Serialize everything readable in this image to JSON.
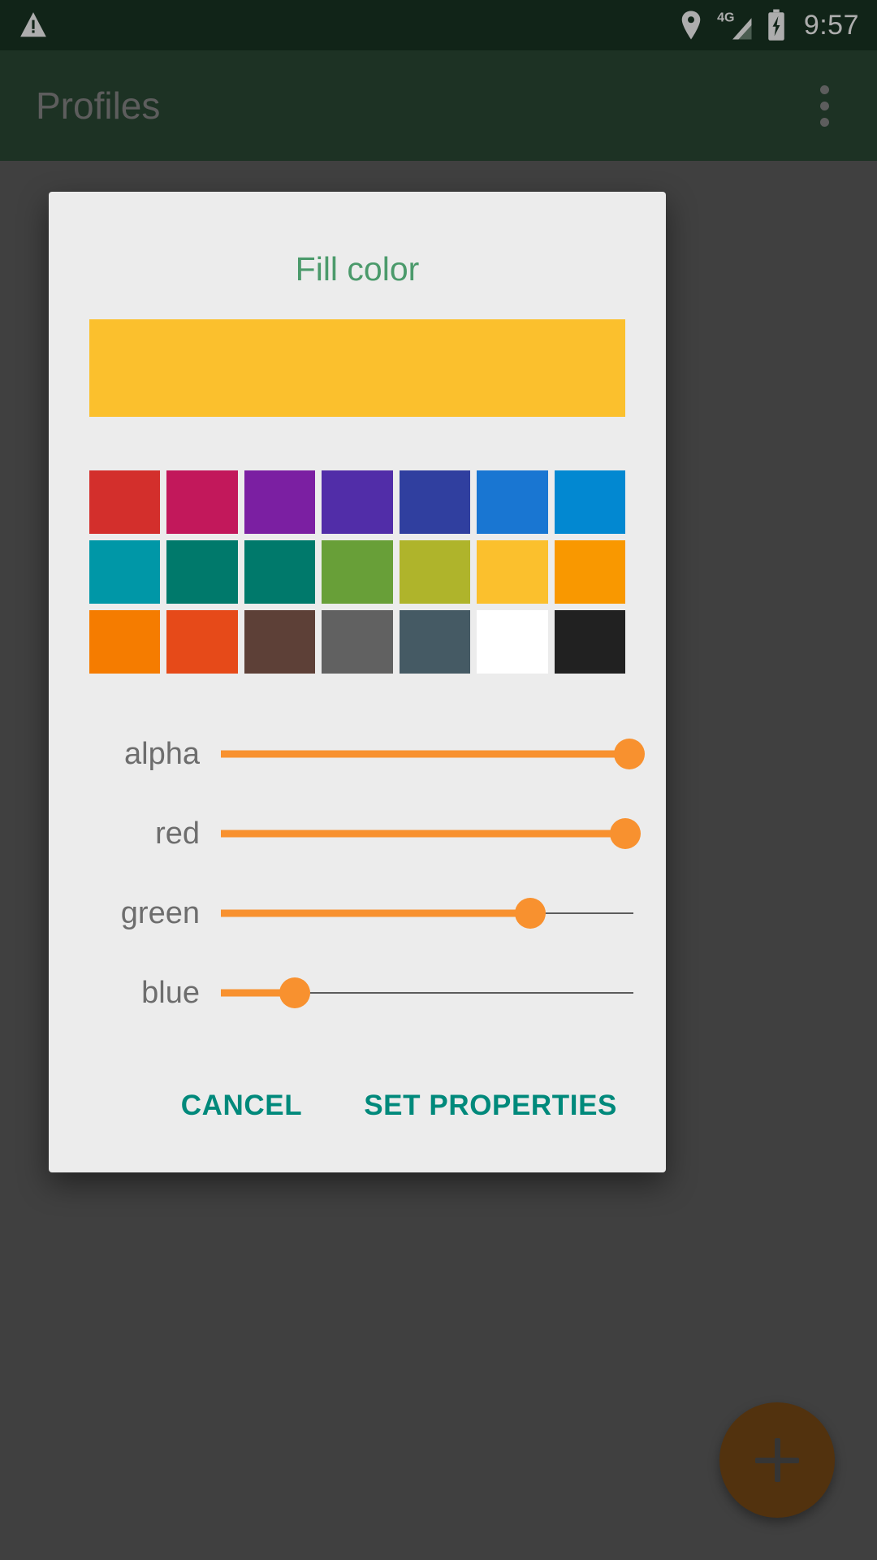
{
  "status_bar": {
    "background": "#1a3524",
    "time": "9:57",
    "icons": [
      "warning-triangle-icon",
      "location-pin-icon",
      "signal-4g-icon",
      "battery-charging-icon"
    ],
    "network_label": "4G"
  },
  "app_bar": {
    "title": "Profiles",
    "background": "#2c4a35",
    "title_color": "#8a8a8a",
    "overflow_icon": "overflow-menu-icon"
  },
  "fab": {
    "icon": "plus-icon",
    "background": "#7a4a16"
  },
  "dialog": {
    "title": "Fill color",
    "title_color": "#4b9a6b",
    "background": "#ececec",
    "preview_color": "#fbc02d",
    "palette": [
      [
        {
          "name": "red",
          "hex": "#d32f2c"
        },
        {
          "name": "pink",
          "hex": "#c2185b"
        },
        {
          "name": "purple",
          "hex": "#7b1fa2"
        },
        {
          "name": "deep-purple",
          "hex": "#512da8"
        },
        {
          "name": "indigo",
          "hex": "#303f9f"
        },
        {
          "name": "blue",
          "hex": "#1976d2"
        },
        {
          "name": "light-blue",
          "hex": "#0288d1"
        }
      ],
      [
        {
          "name": "cyan",
          "hex": "#0097a7"
        },
        {
          "name": "teal",
          "hex": "#00796b"
        },
        {
          "name": "green-teal",
          "hex": "#00796b"
        },
        {
          "name": "light-green",
          "hex": "#689f38"
        },
        {
          "name": "lime",
          "hex": "#afb42b"
        },
        {
          "name": "amber",
          "hex": "#fbc02d"
        },
        {
          "name": "orange",
          "hex": "#f99800"
        }
      ],
      [
        {
          "name": "dark-orange",
          "hex": "#f57c00"
        },
        {
          "name": "deep-orange",
          "hex": "#e64a19"
        },
        {
          "name": "brown",
          "hex": "#5d4037"
        },
        {
          "name": "grey",
          "hex": "#616161"
        },
        {
          "name": "blue-grey",
          "hex": "#455a64"
        },
        {
          "name": "white",
          "hex": "#ffffff"
        },
        {
          "name": "black",
          "hex": "#212121"
        }
      ]
    ],
    "sliders": [
      {
        "label": "alpha",
        "percent": 99
      },
      {
        "label": "red",
        "percent": 98
      },
      {
        "label": "green",
        "percent": 75
      },
      {
        "label": "blue",
        "percent": 18
      }
    ],
    "slider_track_color": "#f8912f",
    "slider_bg_color": "#5c5c5c",
    "actions": {
      "cancel_label": "CANCEL",
      "confirm_label": "SET PROPERTIES",
      "color": "#00897b"
    }
  }
}
